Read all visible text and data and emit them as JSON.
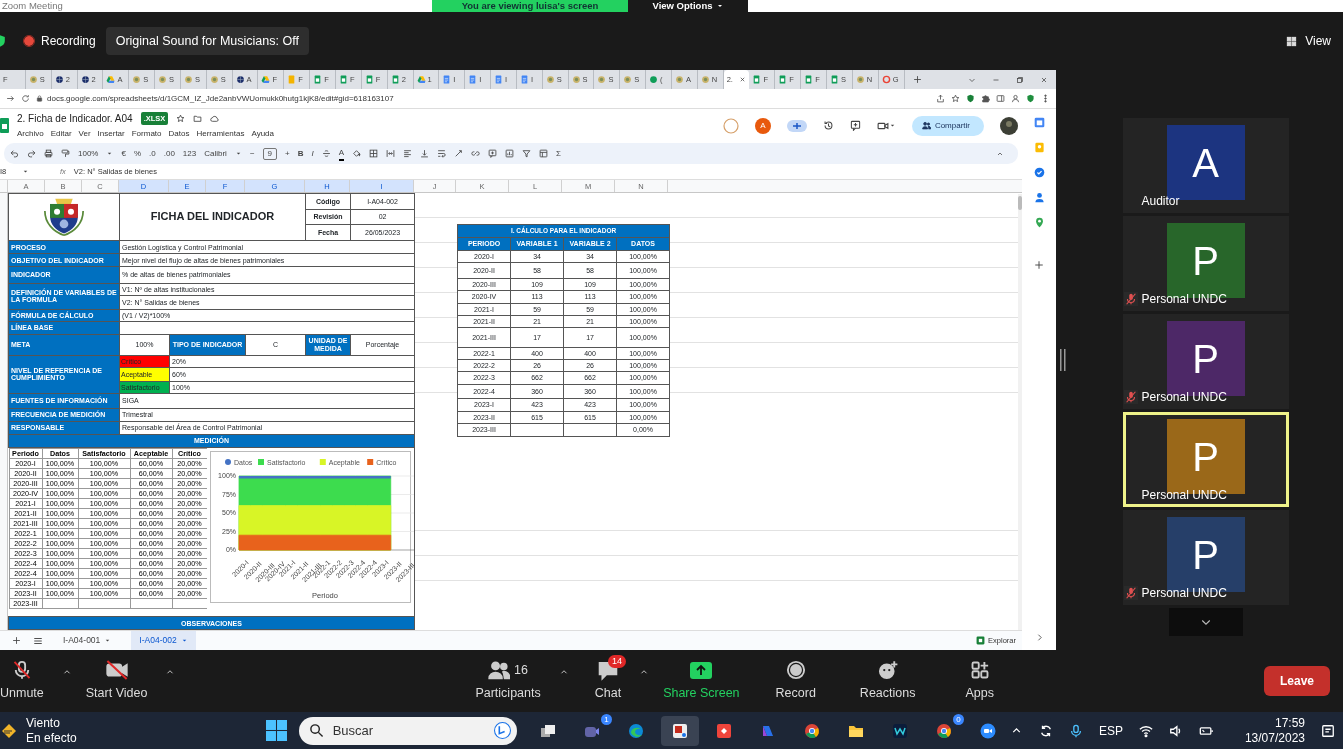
{
  "meeting_header": {
    "title": "Zoom Meeting",
    "banner": "You are viewing luisa's screen",
    "view_options": "View Options"
  },
  "top_bar": {
    "recording": "Recording",
    "original_sound": "Original Sound for Musicians: Off",
    "view": "View"
  },
  "browser": {
    "tabs": [
      {
        "label": "F",
        "kind": "none",
        "selected": false
      },
      {
        "label": "S",
        "kind": "crest",
        "selected": false
      },
      {
        "label": "2",
        "kind": "globe",
        "selected": false
      },
      {
        "label": "2",
        "kind": "globe",
        "selected": false
      },
      {
        "label": "A",
        "kind": "drive",
        "selected": false
      },
      {
        "label": "S",
        "kind": "crest",
        "selected": false
      },
      {
        "label": "S",
        "kind": "crest",
        "selected": false
      },
      {
        "label": "S",
        "kind": "crest",
        "selected": false
      },
      {
        "label": "S",
        "kind": "crest",
        "selected": false
      },
      {
        "label": "A",
        "kind": "globe",
        "selected": false
      },
      {
        "label": "F",
        "kind": "drive",
        "selected": false
      },
      {
        "label": "F",
        "kind": "keep",
        "selected": false
      },
      {
        "label": "F",
        "kind": "sheets",
        "selected": false
      },
      {
        "label": "F",
        "kind": "sheets",
        "selected": false
      },
      {
        "label": "F",
        "kind": "sheets",
        "selected": false
      },
      {
        "label": "2",
        "kind": "sheets",
        "selected": false
      },
      {
        "label": "1",
        "kind": "drive",
        "selected": false
      },
      {
        "label": "I",
        "kind": "docs",
        "selected": false
      },
      {
        "label": "I",
        "kind": "docs",
        "selected": false
      },
      {
        "label": "I",
        "kind": "docs",
        "selected": false
      },
      {
        "label": "I",
        "kind": "docs",
        "selected": false
      },
      {
        "label": "S",
        "kind": "crest",
        "selected": false
      },
      {
        "label": "S",
        "kind": "crest",
        "selected": false
      },
      {
        "label": "S",
        "kind": "crest",
        "selected": false
      },
      {
        "label": "S",
        "kind": "crest",
        "selected": false
      },
      {
        "label": "(",
        "kind": "dot",
        "selected": false
      },
      {
        "label": "A",
        "kind": "crest",
        "selected": false
      },
      {
        "label": "N",
        "kind": "crest",
        "selected": false
      },
      {
        "label": "2.",
        "kind": "none",
        "selected": true
      },
      {
        "label": "F",
        "kind": "sheets",
        "selected": false
      },
      {
        "label": "F",
        "kind": "sheets",
        "selected": false
      },
      {
        "label": "F",
        "kind": "sheets",
        "selected": false
      },
      {
        "label": "S",
        "kind": "sheets",
        "selected": false
      },
      {
        "label": "N",
        "kind": "crest",
        "selected": false
      },
      {
        "label": "G",
        "kind": "ring",
        "selected": false
      }
    ],
    "url": "docs.google.com/spreadsheets/d/1GCM_IZ_Jde2anbVWUomukk0hutg1kjK8/edit#gid=618163107"
  },
  "sheets": {
    "title": "2. Ficha de Indicador. A04",
    "format_badge": ".XLSX",
    "menus": [
      "Archivo",
      "Editar",
      "Ver",
      "Insertar",
      "Formato",
      "Datos",
      "Herramientas",
      "Ayuda"
    ],
    "collaborator": "A",
    "share": "Compartir",
    "toolbar": [
      {
        "kind": "undo"
      },
      {
        "kind": "redo"
      },
      {
        "kind": "print"
      },
      {
        "kind": "paint"
      },
      {
        "kind": "dropdown",
        "label": "100%"
      },
      {
        "kind": "text",
        "label": "€"
      },
      {
        "kind": "text",
        "label": "%"
      },
      {
        "kind": "text",
        "label": ".0"
      },
      {
        "kind": "text",
        "label": ".00"
      },
      {
        "kind": "text",
        "label": "123"
      },
      {
        "kind": "dropdown",
        "label": "Calibri"
      },
      {
        "kind": "text",
        "label": "−"
      },
      {
        "kind": "field",
        "label": "9"
      },
      {
        "kind": "text",
        "label": "+"
      },
      {
        "kind": "bold",
        "label": "B"
      },
      {
        "kind": "italic",
        "label": "I"
      },
      {
        "kind": "strike"
      },
      {
        "kind": "textcolor",
        "label": "A"
      },
      {
        "kind": "fill"
      },
      {
        "kind": "borders"
      },
      {
        "kind": "merge"
      },
      {
        "kind": "align"
      },
      {
        "kind": "valign"
      },
      {
        "kind": "wrap"
      },
      {
        "kind": "rotate"
      },
      {
        "kind": "link"
      },
      {
        "kind": "comment"
      },
      {
        "kind": "chart"
      },
      {
        "kind": "filter"
      },
      {
        "kind": "views"
      },
      {
        "kind": "text",
        "label": "Σ"
      }
    ],
    "name_box": "I8",
    "fx": "fx",
    "formula": "V2: N° Salidas de bienes",
    "columns": [
      {
        "label": "A",
        "selected": false
      },
      {
        "label": "B",
        "selected": false
      },
      {
        "label": "C",
        "selected": false
      },
      {
        "label": "D",
        "selected": true
      },
      {
        "label": "E",
        "selected": true
      },
      {
        "label": "F",
        "selected": true
      },
      {
        "label": "G",
        "selected": true
      },
      {
        "label": "H",
        "selected": true
      },
      {
        "label": "I",
        "selected": true
      },
      {
        "label": "J",
        "selected": false
      },
      {
        "label": "K",
        "selected": false
      },
      {
        "label": "L",
        "selected": false
      },
      {
        "label": "M",
        "selected": false
      },
      {
        "label": "N",
        "selected": false
      }
    ],
    "form": {
      "title": "FICHA DEL INDICADOR",
      "meta": [
        {
          "label": "Código",
          "value": "I-A04-002"
        },
        {
          "label": "Revisión",
          "value": "02"
        },
        {
          "label": "Fecha",
          "value": "26/05/2023"
        }
      ],
      "rows": [
        {
          "kind": "text",
          "label": "PROCESO",
          "values": [
            "Gestión Logística y Control Patrimonial"
          ]
        },
        {
          "kind": "text",
          "label": "OBJETIVO DEL INDICADOR",
          "values": [
            "Mejor nivel del flujo de altas de bienes patrimoniales"
          ]
        },
        {
          "kind": "text",
          "label": "INDICADOR",
          "values": [
            "% de altas de bienes patrimoniales"
          ]
        },
        {
          "kind": "text",
          "label": "DEFINICIÓN DE VARIABLES DE LA FORMULA",
          "values": [
            "V1: Nº de altas institucionales",
            "V2: N° Salidas de bienes"
          ]
        },
        {
          "kind": "text",
          "label": "FÓRMULA DE CÁLCULO",
          "values": [
            "(V1 / V2)*100%"
          ]
        },
        {
          "kind": "text",
          "label": "LÍNEA BASE"
        },
        {
          "kind": "meta",
          "label": "META",
          "cells": [
            {
              "text": "100%",
              "header": false
            },
            {
              "text": "TIPO DE INDICADOR",
              "header": true
            },
            {
              "text": "C",
              "header": false
            },
            {
              "text": "UNIDAD DE MEDIDA",
              "header": true
            },
            {
              "text": "Porcentaje",
              "header": false
            }
          ]
        },
        {
          "kind": "levels",
          "label": "NIVEL DE REFERENCIA DE CUMPLIMIENTO",
          "levels": [
            {
              "name": "Crítico",
              "color": "#ff0000",
              "value": "20%"
            },
            {
              "name": "Aceptable",
              "color": "#ffff00",
              "value": "60%"
            },
            {
              "name": "Satisfactorio",
              "color": "#00b050",
              "value": "100%"
            }
          ]
        },
        {
          "kind": "text",
          "label": "FUENTES DE INFORMACIÓN",
          "values": [
            "SIGA"
          ]
        },
        {
          "kind": "text",
          "label": "FRECUENCIA DE MEDICIÓN",
          "values": [
            "Trimestral"
          ]
        },
        {
          "kind": "text",
          "label": "RESPONSABLE",
          "values": [
            "Responsable del Área de Control Patrimonial"
          ]
        }
      ],
      "section": "MEDICIÓN",
      "measure": {
        "columns": [
          "Periodo",
          "Datos",
          "Satisfactorio",
          "Aceptable",
          "Crítico"
        ],
        "rows": [
          [
            "2020-I",
            "100,00%",
            "100,00%",
            "60,00%",
            "20,00%"
          ],
          [
            "2020-II",
            "100,00%",
            "100,00%",
            "60,00%",
            "20,00%"
          ],
          [
            "2020-III",
            "100,00%",
            "100,00%",
            "60,00%",
            "20,00%"
          ],
          [
            "2020-IV",
            "100,00%",
            "100,00%",
            "60,00%",
            "20,00%"
          ],
          [
            "2021-I",
            "100,00%",
            "100,00%",
            "60,00%",
            "20,00%"
          ],
          [
            "2021-II",
            "100,00%",
            "100,00%",
            "60,00%",
            "20,00%"
          ],
          [
            "2021-III",
            "100,00%",
            "100,00%",
            "60,00%",
            "20,00%"
          ],
          [
            "2022-1",
            "100,00%",
            "100,00%",
            "60,00%",
            "20,00%"
          ],
          [
            "2022-2",
            "100,00%",
            "100,00%",
            "60,00%",
            "20,00%"
          ],
          [
            "2022-3",
            "100,00%",
            "100,00%",
            "60,00%",
            "20,00%"
          ],
          [
            "2022-4",
            "100,00%",
            "100,00%",
            "60,00%",
            "20,00%"
          ],
          [
            "2022-4",
            "100,00%",
            "100,00%",
            "60,00%",
            "20,00%"
          ],
          [
            "2023-I",
            "100,00%",
            "100,00%",
            "60,00%",
            "20,00%"
          ],
          [
            "2023-II",
            "100,00%",
            "100,00%",
            "60,00%",
            "20,00%"
          ],
          [
            "2023-III"
          ]
        ]
      },
      "chart_data": {
        "type": "area",
        "xlabel": "Periodo",
        "stacked": false,
        "grid": true,
        "legend": true,
        "categories": [
          "2020-I",
          "2020-II",
          "2020-III",
          "2020-IV",
          "2021-I",
          "2021-II",
          "2021-III",
          "2022-1",
          "2022-2",
          "2022-3",
          "2022-4",
          "2022-4",
          "2023-I",
          "2023-II",
          "2023-III"
        ],
        "series": [
          {
            "name": "Datos",
            "color": "#4472c4",
            "values": [
              100,
              100,
              100,
              100,
              100,
              100,
              100,
              100,
              100,
              100,
              100,
              100,
              100,
              100,
              null
            ]
          },
          {
            "name": "Satisfactorio",
            "color": "#3ddc4e",
            "values": [
              100,
              100,
              100,
              100,
              100,
              100,
              100,
              100,
              100,
              100,
              100,
              100,
              100,
              100,
              null
            ]
          },
          {
            "name": "Aceptable",
            "color": "#d8f526",
            "values": [
              60,
              60,
              60,
              60,
              60,
              60,
              60,
              60,
              60,
              60,
              60,
              60,
              60,
              60,
              null
            ]
          },
          {
            "name": "Crítico",
            "color": "#e8621c",
            "values": [
              20,
              20,
              20,
              20,
              20,
              20,
              20,
              20,
              20,
              20,
              20,
              20,
              20,
              20,
              null
            ]
          }
        ],
        "ylim": [
          0,
          100
        ],
        "yticks": [
          {
            "value": 0,
            "label": "0%"
          },
          {
            "value": 25,
            "label": "25%"
          },
          {
            "value": 50,
            "label": "50%"
          },
          {
            "value": 75,
            "label": "75%"
          },
          {
            "value": 100,
            "label": "100%"
          }
        ]
      },
      "footer": "OBSERVACIONES"
    },
    "calc_table": {
      "title": "I. CÁLCULO PARA EL INDICADOR",
      "columns": [
        "PERIODO",
        "VARIABLE 1",
        "VARIABLE 2",
        "DATOS"
      ],
      "rows": [
        [
          "2020-I",
          "34",
          "34",
          "100,00%"
        ],
        [
          "2020-II",
          "58",
          "58",
          "100,00%"
        ],
        [
          "2020-III",
          "109",
          "109",
          "100,00%"
        ],
        [
          "2020-IV",
          "113",
          "113",
          "100,00%"
        ],
        [
          "2021-I",
          "59",
          "59",
          "100,00%"
        ],
        [
          "2021-II",
          "21",
          "21",
          "100,00%"
        ],
        [
          "2021-III",
          "17",
          "17",
          "100,00%"
        ],
        [
          "2022-1",
          "400",
          "400",
          "100,00%"
        ],
        [
          "2022-2",
          "26",
          "26",
          "100,00%"
        ],
        [
          "2022-3",
          "662",
          "662",
          "100,00%"
        ],
        [
          "2022-4",
          "360",
          "360",
          "100,00%"
        ],
        [
          "2023-I",
          "423",
          "423",
          "100,00%"
        ],
        [
          "2023-II",
          "615",
          "615",
          "100,00%"
        ],
        [
          "2023-III",
          null,
          null,
          "0,00%"
        ]
      ]
    },
    "sheet_tabs": [
      {
        "label": "I-A04-001",
        "selected": false
      },
      {
        "label": "I-A04-002",
        "selected": true
      }
    ],
    "explore": "Explorar"
  },
  "participants": [
    {
      "initial": "A",
      "name": "Auditor",
      "color": "#1c3480",
      "muted": false,
      "speaking": false
    },
    {
      "initial": "P",
      "name": "Personal UNDC",
      "color": "#28662a",
      "muted": true,
      "speaking": false
    },
    {
      "initial": "P",
      "name": "Personal UNDC",
      "color": "#4d2867",
      "muted": true,
      "speaking": false
    },
    {
      "initial": "P",
      "name": "Personal UNDC",
      "color": "#9a6819",
      "muted": false,
      "speaking": true
    },
    {
      "initial": "P",
      "name": "Personal UNDC",
      "color": "#263f69",
      "muted": true,
      "speaking": false
    }
  ],
  "controls": [
    {
      "kind": "audio",
      "label": "Unmute",
      "muted": true
    },
    {
      "kind": "video",
      "label": "Start Video",
      "muted": true
    },
    {
      "kind": "participants",
      "label": "Participants",
      "count": "16"
    },
    {
      "kind": "chat",
      "label": "Chat",
      "badge": "14"
    },
    {
      "kind": "share",
      "label": "Share Screen"
    },
    {
      "kind": "record",
      "label": "Record"
    },
    {
      "kind": "reactions",
      "label": "Reactions"
    },
    {
      "kind": "apps",
      "label": "Apps"
    }
  ],
  "leave": "Leave",
  "taskbar": {
    "weather": {
      "title": "Viento",
      "subtitle": "En efecto"
    },
    "search": {
      "placeholder": "Buscar"
    },
    "apps": [
      {
        "kind": "taskview",
        "active": false
      },
      {
        "kind": "meet",
        "badge": "1",
        "active": false
      },
      {
        "kind": "edge",
        "active": false
      },
      {
        "kind": "snip",
        "active": true
      },
      {
        "kind": "remote",
        "active": false
      },
      {
        "kind": "assist",
        "active": false
      },
      {
        "kind": "chrome",
        "active": false
      },
      {
        "kind": "folder",
        "active": false
      },
      {
        "kind": "webex",
        "active": false
      },
      {
        "kind": "chrome",
        "badge": "0",
        "active": false
      },
      {
        "kind": "zoom",
        "active": false
      }
    ],
    "language": "ESP",
    "time": "17:59",
    "date": "13/07/2023"
  }
}
